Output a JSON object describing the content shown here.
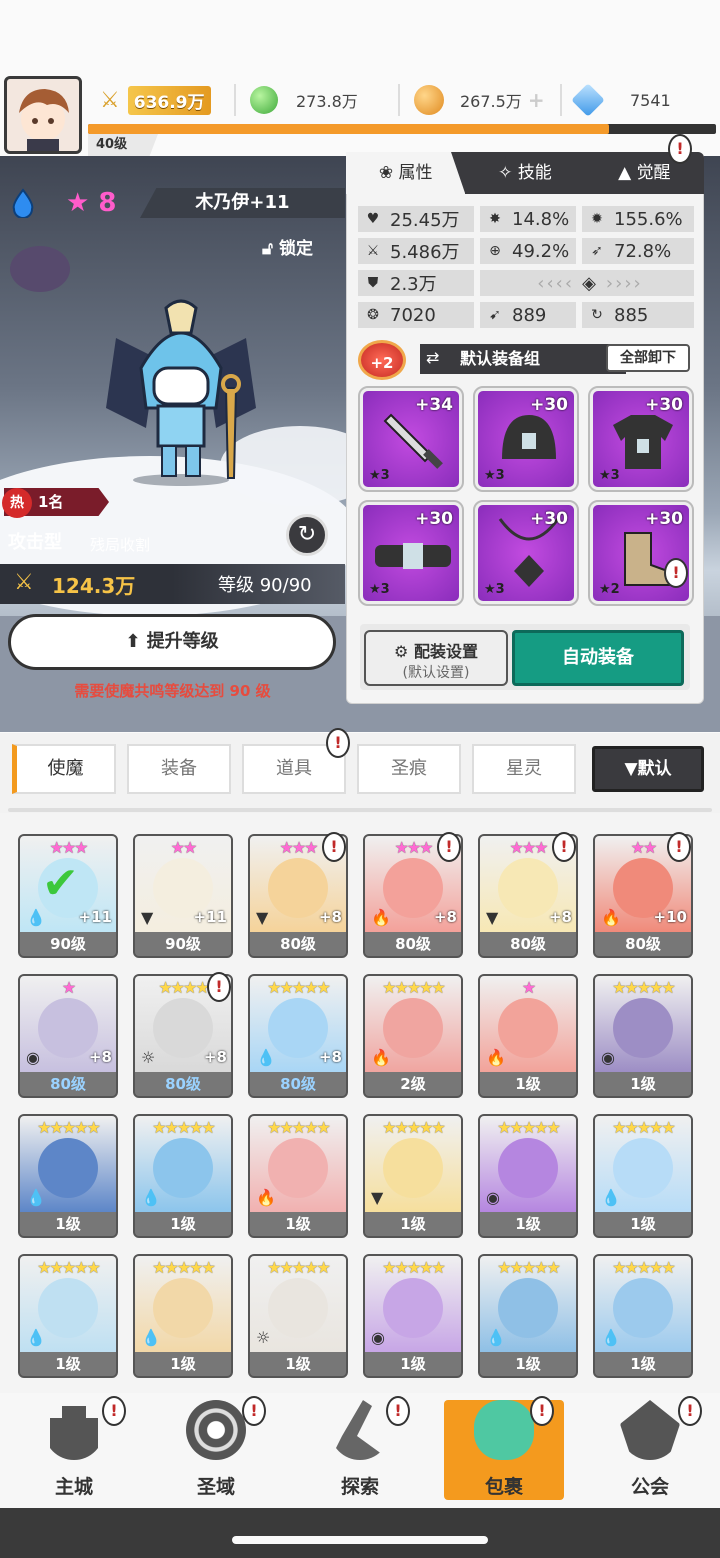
{
  "header": {
    "level_label": "40级",
    "power": "636.9万",
    "resources": [
      {
        "name": "green-gem",
        "value": "273.8万",
        "color": "#5ccb4a"
      },
      {
        "name": "gold-coin",
        "value": "267.5万",
        "color": "#f0a53a"
      },
      {
        "name": "blue-diamond",
        "value": "7541",
        "color": "#6ab5ff"
      }
    ],
    "xp_fraction": 0.83
  },
  "hero": {
    "stars": "8",
    "name": "木乃伊+11",
    "lock_label": "锁定",
    "rank_label": "热",
    "rank_value": "1名",
    "type": "攻击型",
    "subtype": "残局收割",
    "power": "124.3万",
    "level": "等级 90/90",
    "upgrade_label": "提升等级",
    "requirement": "需要使魔共鸣等级达到 90 级"
  },
  "panel": {
    "tabs": [
      "属性",
      "技能",
      "觉醒"
    ],
    "stats": [
      {
        "icon": "heart-icon",
        "glyph": "♥",
        "value": "25.45万"
      },
      {
        "icon": "burst-icon",
        "glyph": "✸",
        "value": "14.8%"
      },
      {
        "icon": "gear-burst-icon",
        "glyph": "✹",
        "value": "155.6%"
      },
      {
        "icon": "sword-icon",
        "glyph": "⚔",
        "value": "5.486万"
      },
      {
        "icon": "crosshair-icon",
        "glyph": "⊕",
        "value": "49.2%"
      },
      {
        "icon": "wing-icon",
        "glyph": "➶",
        "value": "72.8%"
      },
      {
        "icon": "shield-icon",
        "glyph": "⛊",
        "value": "2.3万"
      },
      {
        "icon": "swirl-icon",
        "glyph": "❂",
        "value": "7020"
      },
      {
        "icon": "dash-icon",
        "glyph": "➹",
        "value": "889"
      },
      {
        "icon": "spiral-icon",
        "glyph": "↻",
        "value": "885"
      }
    ],
    "bonus_badge": "+2",
    "set_name": "默认装备组",
    "unequip_all": "全部卸下",
    "slots": [
      {
        "plus": "+34",
        "stars": "★3",
        "icon": "sword-icon"
      },
      {
        "plus": "+30",
        "stars": "★3",
        "icon": "helmet-icon"
      },
      {
        "plus": "+30",
        "stars": "★3",
        "icon": "armor-icon"
      },
      {
        "plus": "+30",
        "stars": "★3",
        "icon": "belt-icon"
      },
      {
        "plus": "+30",
        "stars": "★3",
        "icon": "necklace-icon"
      },
      {
        "plus": "+30",
        "stars": "★2",
        "icon": "boots-icon"
      }
    ],
    "config_label": "配装设置",
    "config_sub": "(默认设置)",
    "auto_equip": "自动装备"
  },
  "categories": [
    "使魔",
    "装备",
    "道具",
    "圣痕",
    "星灵"
  ],
  "sort_label": "▼默认",
  "cards": [
    {
      "stars": "★★★",
      "gold": false,
      "plus": "+11",
      "level": "90级",
      "blue": false,
      "el": "💧",
      "color": "#bfe6f5",
      "alert": false
    },
    {
      "stars": "★★",
      "gold": false,
      "plus": "+11",
      "level": "90级",
      "blue": false,
      "el": "▼",
      "color": "#f4eedf",
      "alert": false
    },
    {
      "stars": "★★★",
      "gold": false,
      "plus": "+8",
      "level": "80级",
      "blue": false,
      "el": "▼",
      "color": "#f5d39a",
      "alert": true
    },
    {
      "stars": "★★★",
      "gold": false,
      "plus": "+8",
      "level": "80级",
      "blue": false,
      "el": "🔥",
      "color": "#f3a19a",
      "alert": true
    },
    {
      "stars": "★★★",
      "gold": false,
      "plus": "+8",
      "level": "80级",
      "blue": false,
      "el": "▼",
      "color": "#f7e8b5",
      "alert": true
    },
    {
      "stars": "★★",
      "gold": false,
      "plus": "+10",
      "level": "80级",
      "blue": false,
      "el": "🔥",
      "color": "#f08a7a",
      "alert": true
    },
    {
      "stars": "★",
      "gold": false,
      "plus": "+8",
      "level": "80级",
      "blue": true,
      "el": "◉",
      "color": "#c7c0df",
      "alert": false
    },
    {
      "stars": "★★★★",
      "gold": true,
      "plus": "+8",
      "level": "80级",
      "blue": true,
      "el": "☼",
      "color": "#d9d9d9",
      "alert": true
    },
    {
      "stars": "★★★★★",
      "gold": true,
      "plus": "+8",
      "level": "80级",
      "blue": true,
      "el": "💧",
      "color": "#a9d6f5",
      "alert": false
    },
    {
      "stars": "★★★★★",
      "gold": true,
      "plus": "",
      "level": "2级",
      "blue": false,
      "el": "🔥",
      "color": "#f0a5a0",
      "alert": false
    },
    {
      "stars": "★",
      "gold": false,
      "plus": "",
      "level": "1级",
      "blue": false,
      "el": "🔥",
      "color": "#f2a39a",
      "alert": false
    },
    {
      "stars": "★★★★★",
      "gold": true,
      "plus": "",
      "level": "1级",
      "blue": false,
      "el": "◉",
      "color": "#9d8ec5",
      "alert": false
    },
    {
      "stars": "★★★★★",
      "gold": true,
      "plus": "",
      "level": "1级",
      "blue": false,
      "el": "💧",
      "color": "#5d86c8",
      "alert": false
    },
    {
      "stars": "★★★★★",
      "gold": true,
      "plus": "",
      "level": "1级",
      "blue": false,
      "el": "💧",
      "color": "#8cc5ec",
      "alert": false
    },
    {
      "stars": "★★★★★",
      "gold": true,
      "plus": "",
      "level": "1级",
      "blue": false,
      "el": "🔥",
      "color": "#f1b1b0",
      "alert": false
    },
    {
      "stars": "★★★★★",
      "gold": true,
      "plus": "",
      "level": "1级",
      "blue": false,
      "el": "▼",
      "color": "#f6df9d",
      "alert": false
    },
    {
      "stars": "★★★★★",
      "gold": true,
      "plus": "",
      "level": "1级",
      "blue": false,
      "el": "◉",
      "color": "#b586e0",
      "alert": false
    },
    {
      "stars": "★★★★★",
      "gold": true,
      "plus": "",
      "level": "1级",
      "blue": false,
      "el": "💧",
      "color": "#b7dcf7",
      "alert": false
    },
    {
      "stars": "★★★★★",
      "gold": true,
      "plus": "",
      "level": "1级",
      "blue": false,
      "el": "💧",
      "color": "#bfe0f2",
      "alert": false
    },
    {
      "stars": "★★★★★",
      "gold": true,
      "plus": "",
      "level": "1级",
      "blue": false,
      "el": "💧",
      "color": "#f2d8a8",
      "alert": false
    },
    {
      "stars": "★★★★★",
      "gold": true,
      "plus": "",
      "level": "1级",
      "blue": false,
      "el": "☼",
      "color": "#e9e5df",
      "alert": false
    },
    {
      "stars": "★★★★★",
      "gold": true,
      "plus": "",
      "level": "1级",
      "blue": false,
      "el": "◉",
      "color": "#c7a6e6",
      "alert": false
    },
    {
      "stars": "★★★★★",
      "gold": true,
      "plus": "",
      "level": "1级",
      "blue": false,
      "el": "💧",
      "color": "#8fc0e6",
      "alert": false
    },
    {
      "stars": "★★★★★",
      "gold": true,
      "plus": "",
      "level": "1级",
      "blue": false,
      "el": "💧",
      "color": "#9ccaed",
      "alert": false
    }
  ],
  "nav": [
    {
      "label": "主城",
      "icon": "castle-icon"
    },
    {
      "label": "圣域",
      "icon": "vortex-icon"
    },
    {
      "label": "探索",
      "icon": "sword-stone-icon"
    },
    {
      "label": "包裹",
      "icon": "bag-icon"
    },
    {
      "label": "公会",
      "icon": "guild-helmet-icon"
    }
  ]
}
